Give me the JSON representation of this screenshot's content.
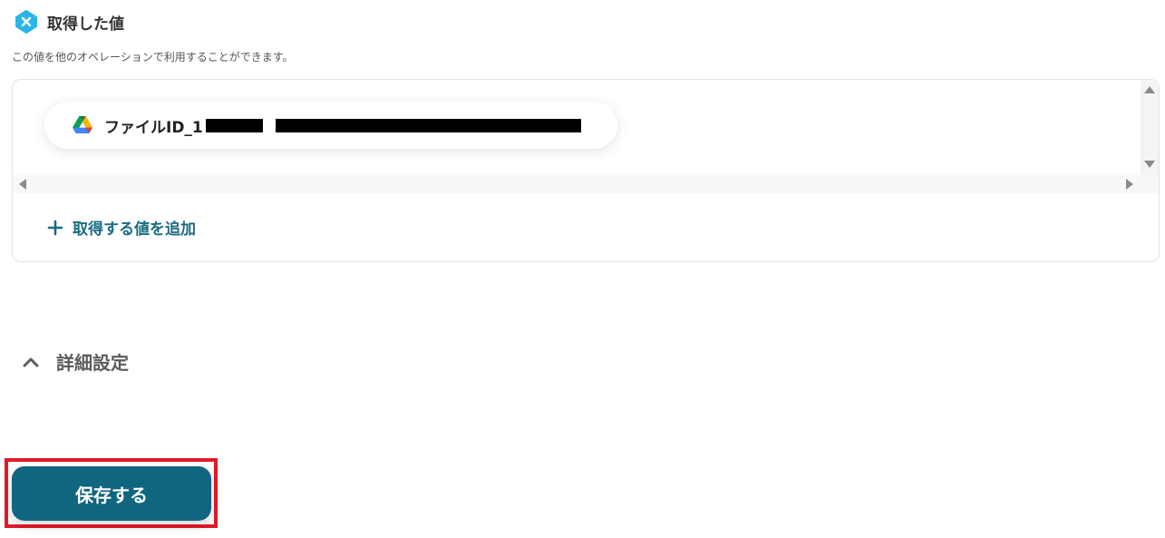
{
  "section": {
    "title": "取得した値",
    "description": "この値を他のオペレーションで利用することができます。",
    "badge_icon": "x-badge-icon",
    "accent_color": "#29b6e6"
  },
  "values": {
    "items": [
      {
        "icon": "google-drive-icon",
        "label": "ファイルID_1"
      }
    ],
    "add_label": "取得する値を追加",
    "add_color": "#1a6b82"
  },
  "advanced": {
    "label": "詳細設定",
    "icon": "chevron-up-icon"
  },
  "save": {
    "label": "保存する",
    "color": "#10657f",
    "highlight_color": "#e21b2a"
  }
}
